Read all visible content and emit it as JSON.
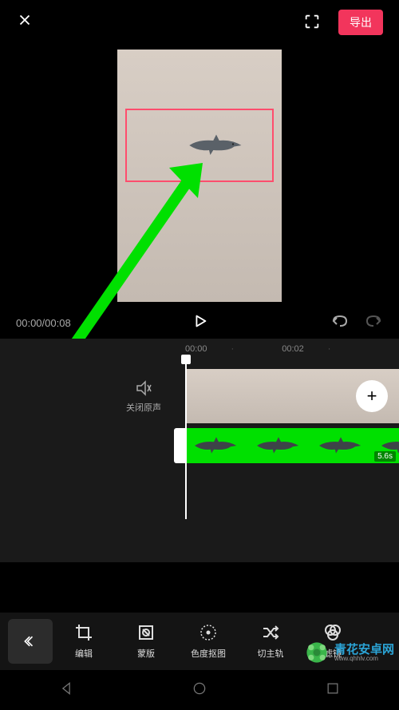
{
  "header": {
    "export_label": "导出"
  },
  "playback": {
    "current_time": "00:00",
    "total_time": "00:08",
    "time_display": "00:00/00:08"
  },
  "timeline": {
    "ruler_marks": [
      "00:00",
      "00:02"
    ],
    "mute_label": "关闭原声",
    "overlay_duration": "5.6s"
  },
  "toolbar": {
    "items": [
      {
        "id": "edit",
        "label": "编辑"
      },
      {
        "id": "mask",
        "label": "蒙版"
      },
      {
        "id": "chroma",
        "label": "色度抠图"
      },
      {
        "id": "maintrack",
        "label": "切主轨"
      },
      {
        "id": "filter",
        "label": "滤镜"
      }
    ]
  },
  "watermark": {
    "brand": "青花安卓网",
    "url": "www.qhhlv.com"
  }
}
